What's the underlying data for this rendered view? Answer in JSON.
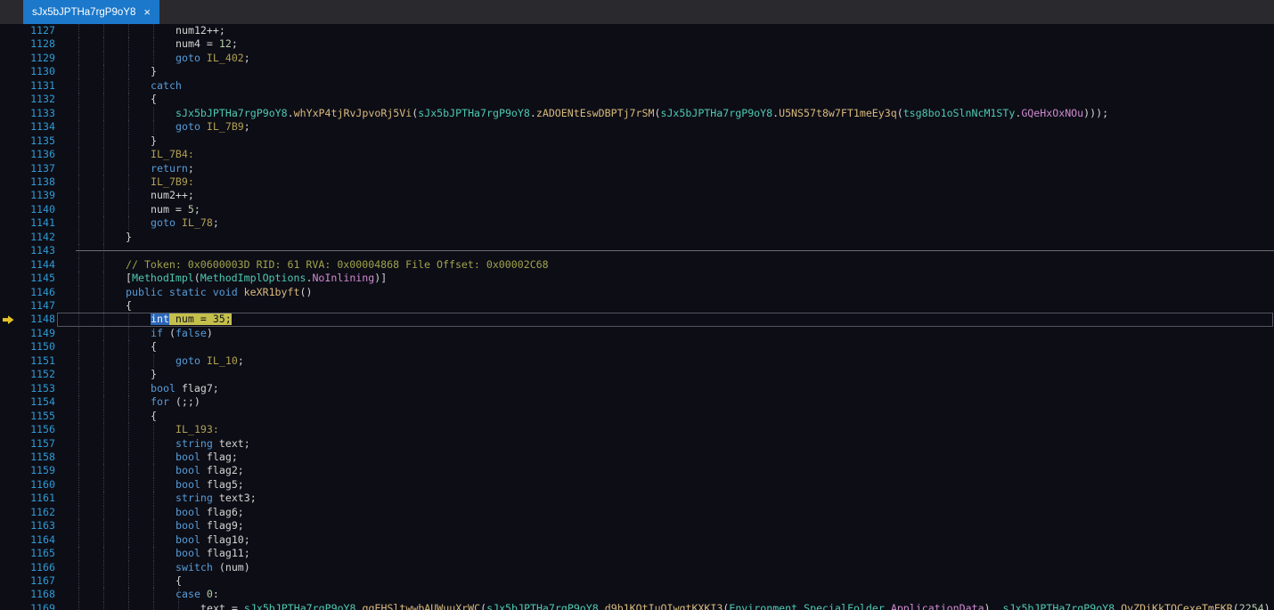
{
  "tab": {
    "title": "sJx5bJPTHa7rgP9oY8",
    "close_label": "×"
  },
  "editor": {
    "current_line": 1148,
    "lines": [
      {
        "n": 1127,
        "indent": 4,
        "guides": [
          0,
          1,
          2,
          3
        ],
        "segs": [
          [
            "pl",
            "num12++;"
          ]
        ]
      },
      {
        "n": 1128,
        "indent": 4,
        "guides": [
          0,
          1,
          2,
          3
        ],
        "segs": [
          [
            "pl",
            "num4 = "
          ],
          [
            "nu",
            "12"
          ],
          [
            "pl",
            ";"
          ]
        ]
      },
      {
        "n": 1129,
        "indent": 4,
        "guides": [
          0,
          1,
          2,
          3
        ],
        "segs": [
          [
            "kw",
            "goto"
          ],
          [
            "pl",
            " "
          ],
          [
            "lb",
            "IL_402"
          ],
          [
            "pl",
            ";"
          ]
        ]
      },
      {
        "n": 1130,
        "indent": 3,
        "guides": [
          0,
          1,
          2
        ],
        "segs": [
          [
            "pl",
            "}"
          ]
        ]
      },
      {
        "n": 1131,
        "indent": 3,
        "guides": [
          0,
          1,
          2
        ],
        "segs": [
          [
            "kw",
            "catch"
          ]
        ]
      },
      {
        "n": 1132,
        "indent": 3,
        "guides": [
          0,
          1,
          2
        ],
        "segs": [
          [
            "pl",
            "{"
          ]
        ]
      },
      {
        "n": 1133,
        "indent": 4,
        "guides": [
          0,
          1,
          2,
          3
        ],
        "segs": [
          [
            "ty",
            "sJx5bJPTHa7rgP9oY8"
          ],
          [
            "pl",
            "."
          ],
          [
            "me",
            "whYxP4tjRvJpvoRj5Vi"
          ],
          [
            "pl",
            "("
          ],
          [
            "ty",
            "sJx5bJPTHa7rgP9oY8"
          ],
          [
            "pl",
            "."
          ],
          [
            "me",
            "zADOENtEswDBPTj7rSM"
          ],
          [
            "pl",
            "("
          ],
          [
            "ty",
            "sJx5bJPTHa7rgP9oY8"
          ],
          [
            "pl",
            "."
          ],
          [
            "me",
            "U5NS57t8w7FT1meEy3q"
          ],
          [
            "pl",
            "("
          ],
          [
            "ty",
            "tsg8bo1oSlnNcM1STy"
          ],
          [
            "pl",
            "."
          ],
          [
            "fi",
            "GQeHxOxNOu"
          ],
          [
            "pl",
            ")));"
          ]
        ]
      },
      {
        "n": 1134,
        "indent": 4,
        "guides": [
          0,
          1,
          2,
          3
        ],
        "segs": [
          [
            "kw",
            "goto"
          ],
          [
            "pl",
            " "
          ],
          [
            "lb",
            "IL_7B9"
          ],
          [
            "pl",
            ";"
          ]
        ]
      },
      {
        "n": 1135,
        "indent": 3,
        "guides": [
          0,
          1,
          2
        ],
        "segs": [
          [
            "pl",
            "}"
          ]
        ]
      },
      {
        "n": 1136,
        "indent": 3,
        "guides": [
          0,
          1,
          2
        ],
        "segs": [
          [
            "lb",
            "IL_7B4:"
          ]
        ]
      },
      {
        "n": 1137,
        "indent": 3,
        "guides": [
          0,
          1,
          2
        ],
        "segs": [
          [
            "kw",
            "return"
          ],
          [
            "pl",
            ";"
          ]
        ]
      },
      {
        "n": 1138,
        "indent": 3,
        "guides": [
          0,
          1,
          2
        ],
        "segs": [
          [
            "lb",
            "IL_7B9:"
          ]
        ]
      },
      {
        "n": 1139,
        "indent": 3,
        "guides": [
          0,
          1,
          2
        ],
        "segs": [
          [
            "pl",
            "num2++;"
          ]
        ]
      },
      {
        "n": 1140,
        "indent": 3,
        "guides": [
          0,
          1,
          2
        ],
        "segs": [
          [
            "pl",
            "num = "
          ],
          [
            "nu",
            "5"
          ],
          [
            "pl",
            ";"
          ]
        ]
      },
      {
        "n": 1141,
        "indent": 3,
        "guides": [
          0,
          1,
          2
        ],
        "segs": [
          [
            "kw",
            "goto"
          ],
          [
            "pl",
            " "
          ],
          [
            "lb",
            "IL_78"
          ],
          [
            "pl",
            ";"
          ]
        ]
      },
      {
        "n": 1142,
        "indent": 2,
        "guides": [
          0,
          1
        ],
        "segs": [
          [
            "pl",
            "}"
          ]
        ]
      },
      {
        "n": 1143,
        "indent": 0,
        "guides": [
          0,
          1
        ],
        "segs": [],
        "separator": true
      },
      {
        "n": 1144,
        "indent": 2,
        "guides": [
          0,
          1
        ],
        "segs": [
          [
            "cm",
            "// Token: 0x0600003D RID: 61 RVA: 0x00004868 File Offset: 0x00002C68"
          ]
        ]
      },
      {
        "n": 1145,
        "indent": 2,
        "guides": [
          0,
          1
        ],
        "segs": [
          [
            "pl",
            "["
          ],
          [
            "ty",
            "MethodImpl"
          ],
          [
            "pl",
            "("
          ],
          [
            "ty",
            "MethodImplOptions"
          ],
          [
            "pl",
            "."
          ],
          [
            "fi",
            "NoInlining"
          ],
          [
            "pl",
            ")]"
          ]
        ]
      },
      {
        "n": 1146,
        "indent": 2,
        "guides": [
          0,
          1
        ],
        "segs": [
          [
            "kw",
            "public"
          ],
          [
            "pl",
            " "
          ],
          [
            "kw",
            "static"
          ],
          [
            "pl",
            " "
          ],
          [
            "kw",
            "void"
          ],
          [
            "pl",
            " "
          ],
          [
            "me",
            "keXR1byft"
          ],
          [
            "pl",
            "()"
          ]
        ]
      },
      {
        "n": 1147,
        "indent": 2,
        "guides": [
          0,
          1
        ],
        "segs": [
          [
            "pl",
            "{"
          ]
        ]
      },
      {
        "n": 1148,
        "indent": 3,
        "guides": [
          0,
          1,
          2
        ],
        "segs": [
          [
            "sel",
            "int"
          ],
          [
            "cur",
            " num = 35;"
          ]
        ]
      },
      {
        "n": 1149,
        "indent": 3,
        "guides": [
          0,
          1,
          2
        ],
        "segs": [
          [
            "kw",
            "if"
          ],
          [
            "pl",
            " ("
          ],
          [
            "kw",
            "false"
          ],
          [
            "pl",
            ")"
          ]
        ]
      },
      {
        "n": 1150,
        "indent": 3,
        "guides": [
          0,
          1,
          2
        ],
        "segs": [
          [
            "pl",
            "{"
          ]
        ]
      },
      {
        "n": 1151,
        "indent": 4,
        "guides": [
          0,
          1,
          2,
          3
        ],
        "segs": [
          [
            "kw",
            "goto"
          ],
          [
            "pl",
            " "
          ],
          [
            "lb",
            "IL_10"
          ],
          [
            "pl",
            ";"
          ]
        ]
      },
      {
        "n": 1152,
        "indent": 3,
        "guides": [
          0,
          1,
          2
        ],
        "segs": [
          [
            "pl",
            "}"
          ]
        ]
      },
      {
        "n": 1153,
        "indent": 3,
        "guides": [
          0,
          1,
          2
        ],
        "segs": [
          [
            "kw",
            "bool"
          ],
          [
            "pl",
            " flag7;"
          ]
        ]
      },
      {
        "n": 1154,
        "indent": 3,
        "guides": [
          0,
          1,
          2
        ],
        "segs": [
          [
            "kw",
            "for"
          ],
          [
            "pl",
            " (;;)"
          ]
        ]
      },
      {
        "n": 1155,
        "indent": 3,
        "guides": [
          0,
          1,
          2
        ],
        "segs": [
          [
            "pl",
            "{"
          ]
        ]
      },
      {
        "n": 1156,
        "indent": 4,
        "guides": [
          0,
          1,
          2,
          3
        ],
        "segs": [
          [
            "lb",
            "IL_193:"
          ]
        ]
      },
      {
        "n": 1157,
        "indent": 4,
        "guides": [
          0,
          1,
          2,
          3
        ],
        "segs": [
          [
            "kw",
            "string"
          ],
          [
            "pl",
            " text;"
          ]
        ]
      },
      {
        "n": 1158,
        "indent": 4,
        "guides": [
          0,
          1,
          2,
          3
        ],
        "segs": [
          [
            "kw",
            "bool"
          ],
          [
            "pl",
            " flag;"
          ]
        ]
      },
      {
        "n": 1159,
        "indent": 4,
        "guides": [
          0,
          1,
          2,
          3
        ],
        "segs": [
          [
            "kw",
            "bool"
          ],
          [
            "pl",
            " flag2;"
          ]
        ]
      },
      {
        "n": 1160,
        "indent": 4,
        "guides": [
          0,
          1,
          2,
          3
        ],
        "segs": [
          [
            "kw",
            "bool"
          ],
          [
            "pl",
            " flag5;"
          ]
        ]
      },
      {
        "n": 1161,
        "indent": 4,
        "guides": [
          0,
          1,
          2,
          3
        ],
        "segs": [
          [
            "kw",
            "string"
          ],
          [
            "pl",
            " text3;"
          ]
        ]
      },
      {
        "n": 1162,
        "indent": 4,
        "guides": [
          0,
          1,
          2,
          3
        ],
        "segs": [
          [
            "kw",
            "bool"
          ],
          [
            "pl",
            " flag6;"
          ]
        ]
      },
      {
        "n": 1163,
        "indent": 4,
        "guides": [
          0,
          1,
          2,
          3
        ],
        "segs": [
          [
            "kw",
            "bool"
          ],
          [
            "pl",
            " flag9;"
          ]
        ]
      },
      {
        "n": 1164,
        "indent": 4,
        "guides": [
          0,
          1,
          2,
          3
        ],
        "segs": [
          [
            "kw",
            "bool"
          ],
          [
            "pl",
            " flag10;"
          ]
        ]
      },
      {
        "n": 1165,
        "indent": 4,
        "guides": [
          0,
          1,
          2,
          3
        ],
        "segs": [
          [
            "kw",
            "bool"
          ],
          [
            "pl",
            " flag11;"
          ]
        ]
      },
      {
        "n": 1166,
        "indent": 4,
        "guides": [
          0,
          1,
          2,
          3
        ],
        "segs": [
          [
            "kw",
            "switch"
          ],
          [
            "pl",
            " (num)"
          ]
        ]
      },
      {
        "n": 1167,
        "indent": 4,
        "guides": [
          0,
          1,
          2,
          3
        ],
        "segs": [
          [
            "pl",
            "{"
          ]
        ]
      },
      {
        "n": 1168,
        "indent": 4,
        "guides": [
          0,
          1,
          2,
          3,
          4
        ],
        "segs": [
          [
            "kw",
            "case"
          ],
          [
            "pl",
            " "
          ],
          [
            "nu",
            "0"
          ],
          [
            "pl",
            ":"
          ]
        ]
      },
      {
        "n": 1169,
        "indent": 5,
        "guides": [
          0,
          1,
          2,
          3,
          4
        ],
        "segs": [
          [
            "pl",
            "text = "
          ],
          [
            "ty",
            "sJx5bJPTHa7rgP9oY8"
          ],
          [
            "pl",
            "."
          ],
          [
            "me",
            "ggEHSltwwbAUWuuXrWC"
          ],
          [
            "pl",
            "("
          ],
          [
            "ty",
            "sJx5bJPTHa7rgP9oY8"
          ],
          [
            "pl",
            "."
          ],
          [
            "me",
            "d9b1KQtIuQIwgtKXKI3"
          ],
          [
            "pl",
            "("
          ],
          [
            "ty",
            "Environment"
          ],
          [
            "pl",
            "."
          ],
          [
            "ty",
            "SpecialFolder"
          ],
          [
            "pl",
            "."
          ],
          [
            "fi",
            "ApplicationData"
          ],
          [
            "pl",
            "), "
          ],
          [
            "ty",
            "sJx5bJPTHa7rgP9oY8"
          ],
          [
            "pl",
            "."
          ],
          [
            "me",
            "QvZDiKkTQCexeTmEKR"
          ],
          [
            "pl",
            "("
          ],
          [
            "nu",
            "2254"
          ],
          [
            "pl",
            ")"
          ]
        ]
      }
    ]
  },
  "colors": {
    "tokens": {
      "pl": "#D4D4D4",
      "kw": "#569CD6",
      "ty": "#4EC9B0",
      "me": "#D8BA7C",
      "nu": "#B5CEA8",
      "cm": "#A0A44A",
      "lb": "#AFA052",
      "fi": "#CE8BCE"
    },
    "selection_bg": "#2B66B8",
    "selection_fg": "#F2F6FC",
    "current_statement_bg": "#C5C04B",
    "current_statement_fg": "#14141C",
    "ui": {
      "editor-bg": "#0D0D16",
      "tabbar-bg": "#29292E",
      "tab-bg": "#1B78CA",
      "tab-fg": "#FFFFFF",
      "line-number": "#2E9BD4",
      "indent-guide": "#3C3C48",
      "separator": "#6E6E6E",
      "current-line-border": "#54545E",
      "arrow": "#E2C226"
    }
  }
}
